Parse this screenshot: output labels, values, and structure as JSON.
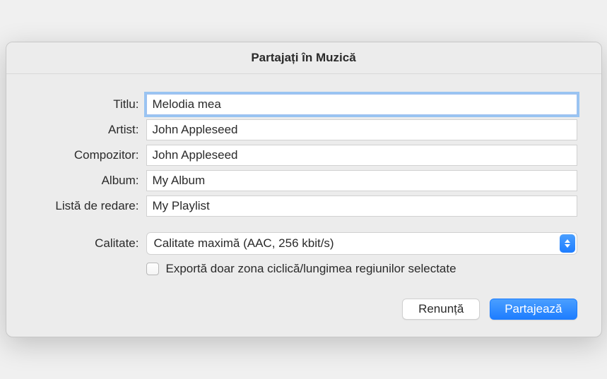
{
  "dialog": {
    "title": "Partajați în Muzică"
  },
  "labels": {
    "title": "Titlu:",
    "artist": "Artist:",
    "composer": "Compozitor:",
    "album": "Album:",
    "playlist": "Listă de redare:",
    "quality": "Calitate:"
  },
  "fields": {
    "title": "Melodia mea",
    "artist": "John Appleseed",
    "composer": "John Appleseed",
    "album": "My Album",
    "playlist": "My Playlist"
  },
  "quality": {
    "selected": "Calitate maximă (AAC, 256 kbit/s)"
  },
  "checkbox": {
    "export_cycle_label": "Exportă doar zona ciclică/lungimea regiunilor selectate",
    "checked": false
  },
  "buttons": {
    "cancel": "Renunță",
    "share": "Partajează"
  }
}
